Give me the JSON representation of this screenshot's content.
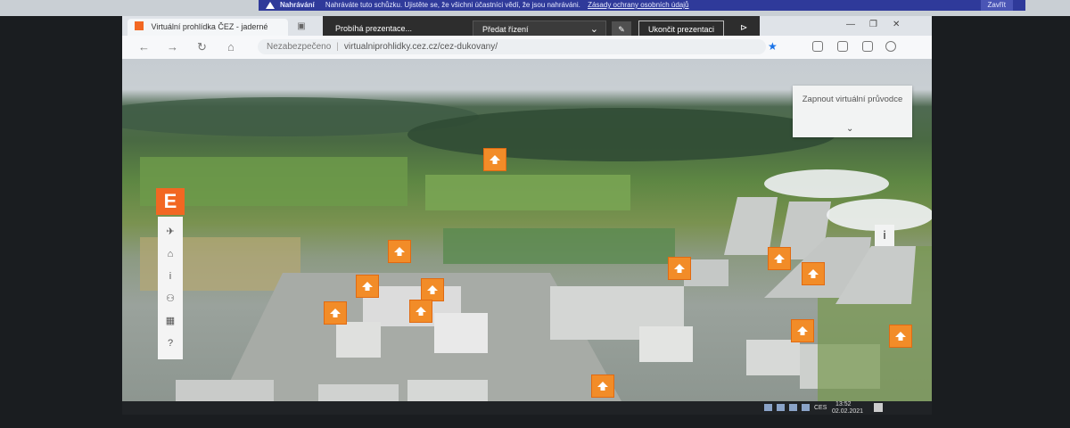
{
  "notification": {
    "title": "Nahrávání",
    "text": "Nahráváte tuto schůzku. Ujistěte se, že všichni účastníci vědí, že jsou nahráváni.",
    "link": "Zásady ochrany osobních údajů",
    "close_label": "Zavřít"
  },
  "browser": {
    "tab_title": "Virtuální prohlídka ČEZ - jaderné",
    "url_security": "Nezabezpečeno",
    "url": "virtualniprohlidky.cez.cz/cez-dukovany/"
  },
  "presentation": {
    "status": "Probíhá prezentace...",
    "control_label": "Předat řízení",
    "stop_label": "Ukončit prezentaci"
  },
  "viewer": {
    "guide_label": "Zapnout virtuální průvodce",
    "logo_letter": "E",
    "info_label": "i",
    "tools": [
      {
        "name": "aircraft-icon",
        "glyph": "✈"
      },
      {
        "name": "home-icon",
        "glyph": "⌂"
      },
      {
        "name": "info-icon",
        "glyph": "i"
      },
      {
        "name": "person-icon",
        "glyph": "⚇"
      },
      {
        "name": "grid-icon",
        "glyph": "▦"
      },
      {
        "name": "help-icon",
        "glyph": "?"
      }
    ],
    "hotspot_count": 12
  },
  "taskbar": {
    "lang": "CES",
    "time": "13:52",
    "date": "02.02.2021"
  },
  "colors": {
    "brand_orange": "#f26722",
    "hotspot_orange": "#f28c28",
    "teams_bar": "#2d2d2d",
    "notify_blue": "#2f3a9a"
  }
}
